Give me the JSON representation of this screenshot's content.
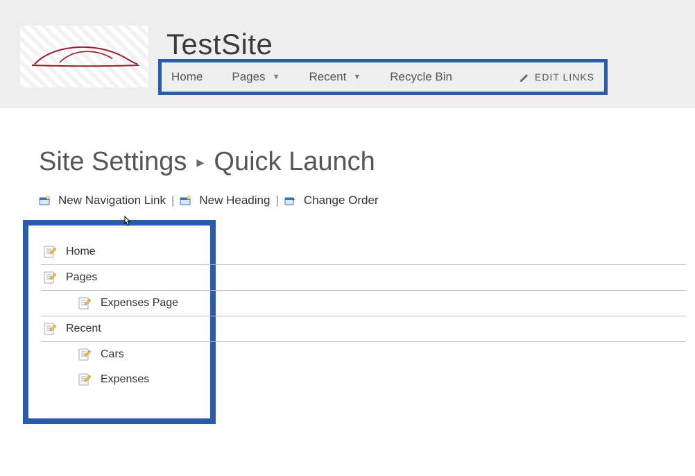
{
  "site": {
    "title": "TestSite"
  },
  "topnav": {
    "items": [
      {
        "label": "Home",
        "dropdown": false
      },
      {
        "label": "Pages",
        "dropdown": true
      },
      {
        "label": "Recent",
        "dropdown": true
      },
      {
        "label": "Recycle Bin",
        "dropdown": false
      }
    ],
    "edit_links": "EDIT LINKS"
  },
  "page": {
    "breadcrumb_parent": "Site Settings",
    "breadcrumb_sep": "▸",
    "breadcrumb_current": "Quick Launch"
  },
  "actions": {
    "new_link": "New Navigation Link",
    "new_head": "New Heading",
    "change_ord": "Change Order",
    "sep": "|"
  },
  "quicklaunch": [
    {
      "label": "Home",
      "children": []
    },
    {
      "label": "Pages",
      "children": [
        {
          "label": "Expenses Page"
        }
      ]
    },
    {
      "label": "Recent",
      "children": [
        {
          "label": "Cars"
        },
        {
          "label": "Expenses"
        }
      ]
    }
  ]
}
